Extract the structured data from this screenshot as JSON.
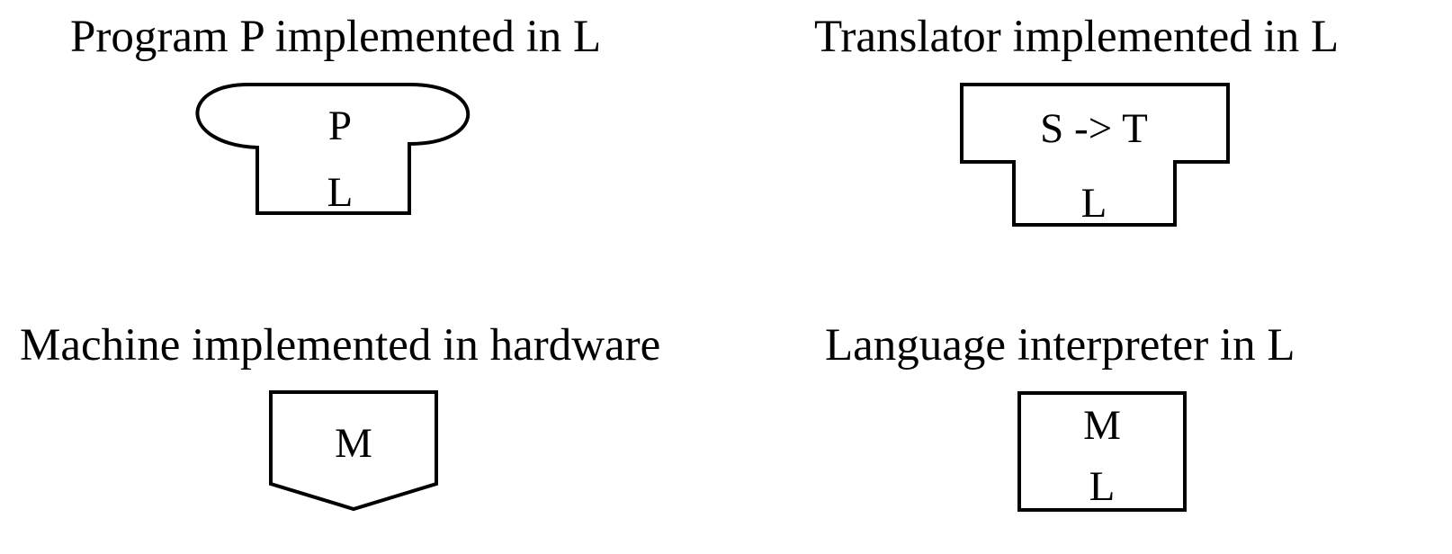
{
  "diagram": {
    "program": {
      "caption": "Program P implemented in L",
      "top_label": "P",
      "bottom_label": "L"
    },
    "translator": {
      "caption": "Translator implemented in L",
      "top_label": "S -> T",
      "bottom_label": "L"
    },
    "machine": {
      "caption": "Machine implemented in hardware",
      "label": "M"
    },
    "interpreter": {
      "caption": "Language interpreter in L",
      "top_label": "M",
      "bottom_label": "L"
    }
  },
  "colors": {
    "stroke": "#000000",
    "background": "#ffffff"
  }
}
